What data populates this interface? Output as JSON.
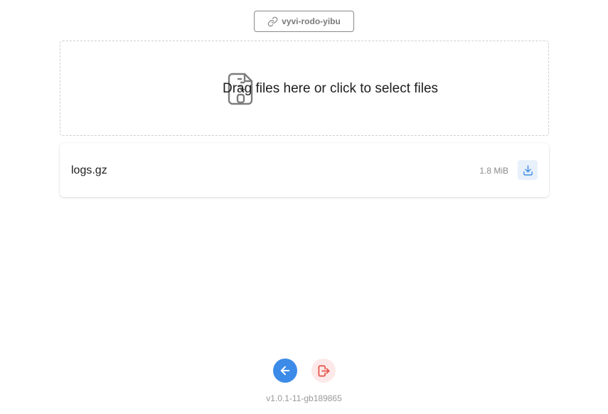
{
  "room": {
    "link_label": "vyvi-rodo-yibu",
    "link_icon": "link-icon"
  },
  "dropzone": {
    "text": "Drag files here or click to select files",
    "icon": "zip-file-icon"
  },
  "files": [
    {
      "name": "logs.gz",
      "size": "1.8 MiB",
      "action_icon": "download-icon"
    }
  ],
  "footer": {
    "back_icon": "arrow-left-icon",
    "exit_icon": "logout-icon",
    "version": "v1.0.1-11-gb189865"
  },
  "colors": {
    "accent": "#3d8be8",
    "danger": "#e5534b",
    "danger_bg": "#fde9e9",
    "download_bg": "#e8f1fb"
  }
}
